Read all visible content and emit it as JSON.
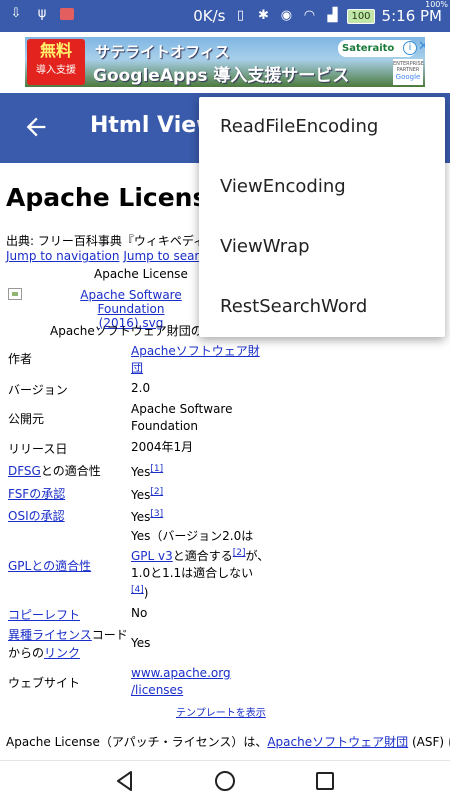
{
  "status_bar": {
    "speed": "0K/s",
    "battery": "100",
    "battery_pct": "100%",
    "time": "5:16 PM"
  },
  "ad": {
    "badge_line1": "無料",
    "badge_line2": "導入支援",
    "headline1": "サテライトオフィス",
    "headline2": "GoogleApps 導入支援サービス",
    "brand": "Sateraito",
    "partner_line1": "ENTERPRISE",
    "partner_line2": "PARTNER",
    "partner_line3": "Google"
  },
  "app_bar": {
    "title": "Html View"
  },
  "menu": {
    "items": [
      "ReadFileEncoding",
      "ViewEncoding",
      "ViewWrap",
      "RestSearchWord"
    ]
  },
  "page": {
    "heading": "Apache License",
    "source": "出典: フリー百科事典『ウィキペディ",
    "jump_nav": "Jump to navigation",
    "jump_search": "Jump to search",
    "infobox_title": "Apache License",
    "image_caption_line1": "Apache Software Foundation",
    "image_caption_line2": "(2016).svg",
    "image_desc": "Apacheソフトウェア財団の",
    "rows": [
      {
        "label": "作者",
        "value1": "Apacheソフトウェア財",
        "value2": "団"
      },
      {
        "label": "バージョン",
        "value1": "2.0"
      },
      {
        "label": "公開元",
        "value1": "Apache Software",
        "value2": "Foundation"
      },
      {
        "label": "リリース日",
        "value1": "2004年1月"
      },
      {
        "label_link": "DFSG",
        "label_rest": "との適合性",
        "value1": "Yes",
        "ref": "[1]"
      },
      {
        "label_link": "FSFの承認",
        "value1": "Yes",
        "ref": "[2]"
      },
      {
        "label_link": "OSIの承認",
        "value1": "Yes",
        "ref": "[3]"
      },
      {
        "label_link": "GPLとの適合性",
        "value1": "Yes（バージョン2.0は",
        "value2_link": "GPL v3",
        "value2_rest": "と適合する",
        "ref2": "[2]",
        "value2_tail": "が、",
        "value3": "1.0と1.1は適合しない",
        "ref4": "[4]",
        "value4": ")"
      },
      {
        "label_link": "コピーレフト",
        "value1": "No"
      },
      {
        "label_link": "異種ライセンス",
        "label_rest": "コード",
        "label2": "からの",
        "label2_link": "リンク",
        "value1": "Yes"
      },
      {
        "label": "ウェブサイト",
        "value1": "www.apache.org",
        "value2": "/licenses"
      }
    ],
    "template_link": "テンプレートを表示",
    "para_start": "Apache License（アパッチ・ライセンス）は、",
    "para_link": "Apacheソフトウェア財団",
    "para_rest": " (ASF) によ"
  },
  "colors": {
    "primary": "#3a5bab",
    "link": "#1a2ec9"
  }
}
